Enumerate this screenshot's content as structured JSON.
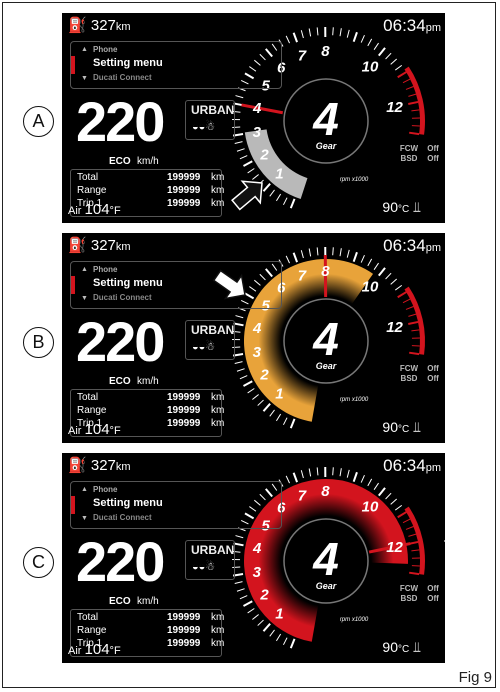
{
  "labels": [
    "A",
    "B",
    "C"
  ],
  "figure_label": "Fig 9",
  "dashboard": {
    "fuel_range": "327",
    "fuel_unit": "km",
    "clock_time": "06:34",
    "clock_ampm": "pm",
    "menu": {
      "prev": "Phone",
      "current": "Setting menu",
      "next": "Ducati Connect"
    },
    "speed": "220",
    "speed_mode": "ECO",
    "speed_unit": "km/h",
    "riding_mode": "URBAN",
    "riding_icons": "◒◒☃",
    "trip": [
      {
        "label": "Total",
        "value": "199999",
        "unit": "km"
      },
      {
        "label": "Range",
        "value": "199999",
        "unit": "km"
      },
      {
        "label": "Trip 1",
        "value": "199999",
        "unit": "km"
      }
    ],
    "air_label": "Air",
    "air_temp": "104",
    "air_unit": "°F",
    "coolant_temp": "90",
    "coolant_unit": "°C",
    "gear": "4",
    "gear_label": "Gear",
    "rpm_label": "rpm x1000",
    "fcw_label": "FCW",
    "fcw_value": "Off",
    "bsd_label": "BSD",
    "bsd_value": "Off",
    "rpm_scale": [
      "1",
      "2",
      "3",
      "4",
      "5",
      "6",
      "7",
      "8",
      "10",
      "12"
    ]
  },
  "highlights": [
    "grey lower arc",
    "orange full inner ring",
    "red full inner ring"
  ],
  "colors": {
    "accent_red": "#d3141e",
    "orange": "#e8a33a",
    "grey": "#b9b9b9"
  }
}
